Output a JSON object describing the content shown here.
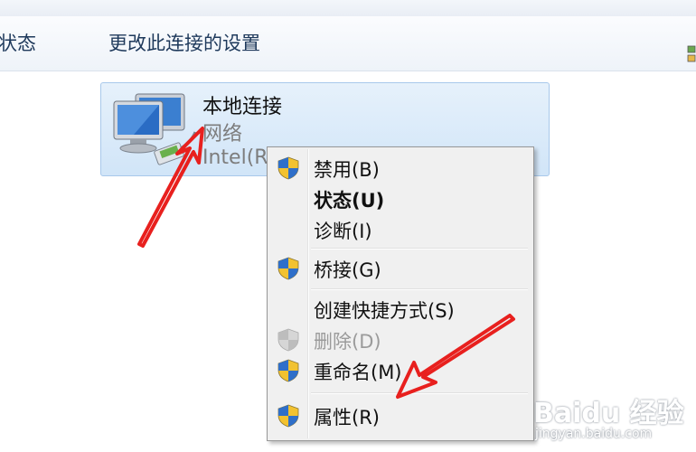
{
  "toolbar": {
    "status_label": "的状态",
    "settings_label": "更改此连接的设置"
  },
  "connection": {
    "name": "本地连接",
    "network": "网络",
    "adapter": "Intel(R"
  },
  "context_menu": {
    "items": [
      {
        "label": "禁用(B)",
        "icon": "uac-shield-icon"
      },
      {
        "label": "状态(U)"
      },
      {
        "label": "诊断(I)"
      },
      {
        "label": "桥接(G)",
        "icon": "uac-shield-icon"
      },
      {
        "label": "创建快捷方式(S)"
      },
      {
        "label": "删除(D)",
        "icon": "uac-shield-icon",
        "disabled": true
      },
      {
        "label": "重命名(M)",
        "icon": "uac-shield-icon"
      },
      {
        "label": "属性(R)",
        "icon": "uac-shield-icon"
      }
    ]
  },
  "annotations": {
    "arrow_color": "#e8201e"
  },
  "watermark": {
    "brand": "Baidu 经验",
    "url": "jingyan.baidu.com"
  }
}
